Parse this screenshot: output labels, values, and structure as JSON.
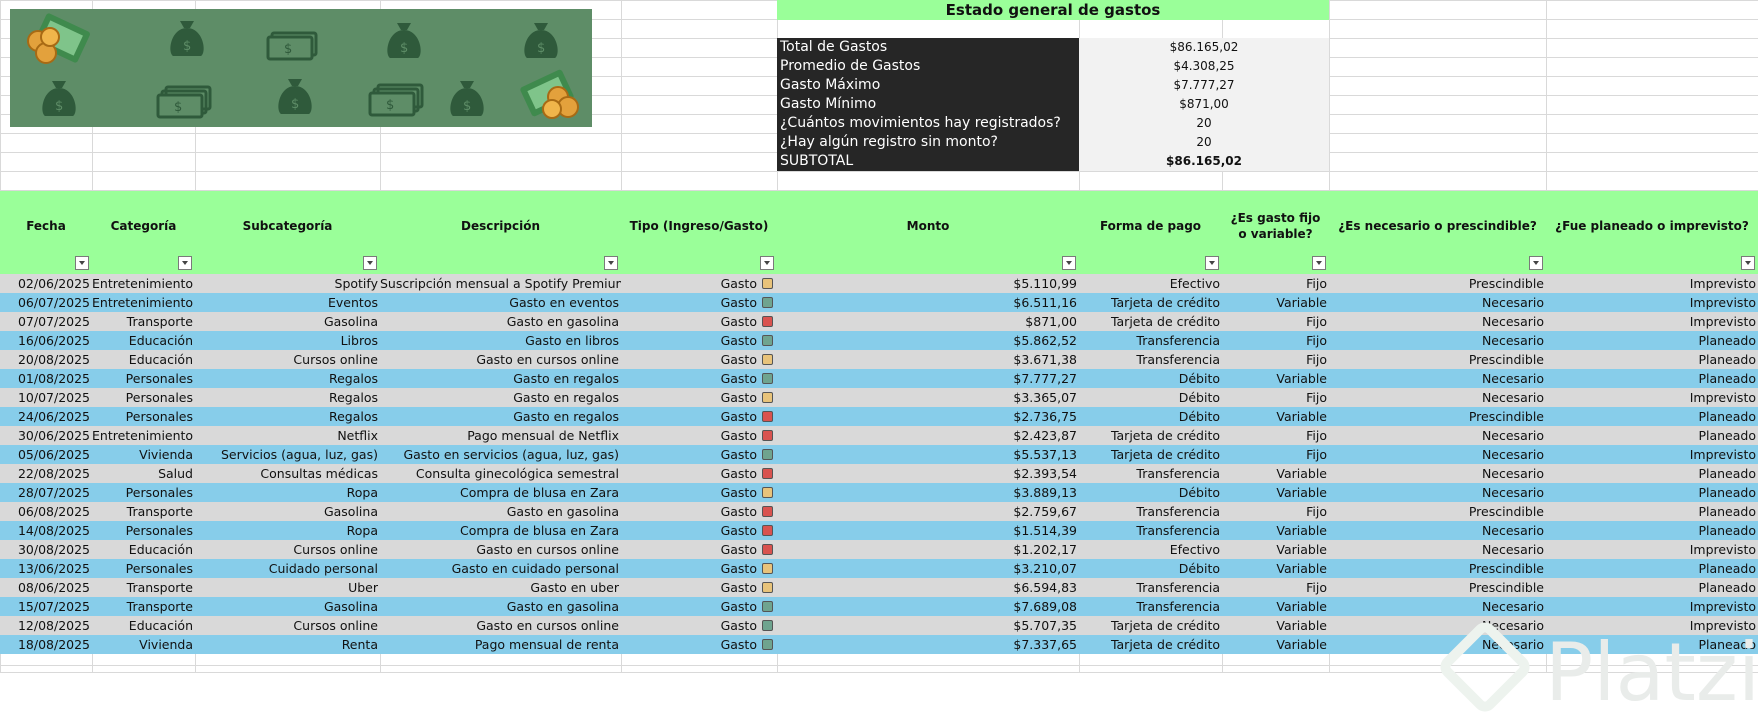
{
  "summary": {
    "title": "Estado general de gastos",
    "rows": [
      {
        "label": "Total de Gastos",
        "value": "$86.165,02"
      },
      {
        "label": "Promedio de Gastos",
        "value": "$4.308,25"
      },
      {
        "label": "Gasto Máximo",
        "value": "$7.777,27"
      },
      {
        "label": "Gasto Mínimo",
        "value": "$871,00"
      },
      {
        "label": "¿Cuántos movimientos hay registrados?",
        "value": "20"
      },
      {
        "label": "¿Hay algún registro sin monto?",
        "value": "20"
      },
      {
        "label": "SUBTOTAL",
        "value": "$86.165,02"
      }
    ]
  },
  "table": {
    "columns": [
      "Fecha",
      "Categoría",
      "Subcategoría",
      "Descripción",
      "Tipo (Ingreso/Gasto)",
      "Monto",
      "Forma de pago",
      "¿Es gasto fijo o variable?",
      "¿Es necesario o prescindible?",
      "¿Fue planeado o imprevisto?"
    ],
    "rows": [
      [
        "02/06/2025",
        "Entretenimiento",
        "Spotify",
        "Suscripción mensual a Spotify Premium",
        "Gasto",
        "$5.110,99",
        "Efectivo",
        "Fijo",
        "Prescindible",
        "Imprevisto"
      ],
      [
        "06/07/2025",
        "Entretenimiento",
        "Eventos",
        "Gasto en eventos",
        "Gasto",
        "$6.511,16",
        "Tarjeta de crédito",
        "Variable",
        "Necesario",
        "Imprevisto"
      ],
      [
        "07/07/2025",
        "Transporte",
        "Gasolina",
        "Gasto en gasolina",
        "Gasto",
        "$871,00",
        "Tarjeta de crédito",
        "Fijo",
        "Necesario",
        "Imprevisto"
      ],
      [
        "16/06/2025",
        "Educación",
        "Libros",
        "Gasto en libros",
        "Gasto",
        "$5.862,52",
        "Transferencia",
        "Fijo",
        "Necesario",
        "Planeado"
      ],
      [
        "20/08/2025",
        "Educación",
        "Cursos online",
        "Gasto en cursos online",
        "Gasto",
        "$3.671,38",
        "Transferencia",
        "Fijo",
        "Prescindible",
        "Planeado"
      ],
      [
        "01/08/2025",
        "Personales",
        "Regalos",
        "Gasto en regalos",
        "Gasto",
        "$7.777,27",
        "Débito",
        "Variable",
        "Necesario",
        "Planeado"
      ],
      [
        "10/07/2025",
        "Personales",
        "Regalos",
        "Gasto en regalos",
        "Gasto",
        "$3.365,07",
        "Débito",
        "Fijo",
        "Necesario",
        "Imprevisto"
      ],
      [
        "24/06/2025",
        "Personales",
        "Regalos",
        "Gasto en regalos",
        "Gasto",
        "$2.736,75",
        "Débito",
        "Variable",
        "Prescindible",
        "Planeado"
      ],
      [
        "30/06/2025",
        "Entretenimiento",
        "Netflix",
        "Pago mensual de Netflix",
        "Gasto",
        "$2.423,87",
        "Tarjeta de crédito",
        "Fijo",
        "Necesario",
        "Planeado"
      ],
      [
        "05/06/2025",
        "Vivienda",
        "Servicios (agua, luz, gas)",
        "Gasto en servicios (agua, luz, gas)",
        "Gasto",
        "$5.537,13",
        "Tarjeta de crédito",
        "Fijo",
        "Necesario",
        "Imprevisto"
      ],
      [
        "22/08/2025",
        "Salud",
        "Consultas médicas",
        "Consulta ginecológica semestral",
        "Gasto",
        "$2.393,54",
        "Transferencia",
        "Variable",
        "Necesario",
        "Planeado"
      ],
      [
        "28/07/2025",
        "Personales",
        "Ropa",
        "Compra de blusa en Zara",
        "Gasto",
        "$3.889,13",
        "Débito",
        "Variable",
        "Necesario",
        "Planeado"
      ],
      [
        "06/08/2025",
        "Transporte",
        "Gasolina",
        "Gasto en gasolina",
        "Gasto",
        "$2.759,67",
        "Transferencia",
        "Fijo",
        "Prescindible",
        "Planeado"
      ],
      [
        "14/08/2025",
        "Personales",
        "Ropa",
        "Compra de blusa en Zara",
        "Gasto",
        "$1.514,39",
        "Transferencia",
        "Variable",
        "Necesario",
        "Planeado"
      ],
      [
        "30/08/2025",
        "Educación",
        "Cursos online",
        "Gasto en cursos online",
        "Gasto",
        "$1.202,17",
        "Efectivo",
        "Variable",
        "Necesario",
        "Imprevisto"
      ],
      [
        "13/06/2025",
        "Personales",
        "Cuidado personal",
        "Gasto en cuidado personal",
        "Gasto",
        "$3.210,07",
        "Débito",
        "Variable",
        "Prescindible",
        "Planeado"
      ],
      [
        "08/06/2025",
        "Transporte",
        "Uber",
        "Gasto en uber",
        "Gasto",
        "$6.594,83",
        "Transferencia",
        "Fijo",
        "Prescindible",
        "Planeado"
      ],
      [
        "15/07/2025",
        "Transporte",
        "Gasolina",
        "Gasto en gasolina",
        "Gasto",
        "$7.689,08",
        "Transferencia",
        "Variable",
        "Necesario",
        "Imprevisto"
      ],
      [
        "12/08/2025",
        "Educación",
        "Cursos online",
        "Gasto en cursos online",
        "Gasto",
        "$5.707,35",
        "Tarjeta de crédito",
        "Variable",
        "Necesario",
        "Imprevisto"
      ],
      [
        "18/08/2025",
        "Vivienda",
        "Renta",
        "Pago mensual de renta",
        "Gasto",
        "$7.337,65",
        "Tarjeta de crédito",
        "Variable",
        "Necesario",
        "Planeado"
      ]
    ],
    "indicator_colors": [
      "#e8c37a",
      "#6fa48f",
      "#d9534f",
      "#6fa48f",
      "#e8c37a",
      "#6fa48f",
      "#e8c37a",
      "#d9534f",
      "#d9534f",
      "#6fa48f",
      "#d9534f",
      "#e8c37a",
      "#d9534f",
      "#d9534f",
      "#d9534f",
      "#e8c37a",
      "#e8c37a",
      "#6fa48f",
      "#6fa48f",
      "#6fa48f"
    ]
  },
  "banner": {
    "icons": [
      "coins-cash-icon",
      "money-bag-icon",
      "banknote-icon",
      "money-bag-icon",
      "money-bag-icon",
      "money-bag-icon",
      "banknote-stack-icon",
      "money-bag-icon",
      "banknote-stack-icon",
      "money-bag-icon",
      "cash-coins-icon"
    ]
  },
  "watermark": "Platzi",
  "colors": {
    "header_green": "#9aff99",
    "row_gray": "#d9d9d9",
    "row_blue": "#87cdea",
    "summary_dark": "#262626",
    "banner_green": "#5e8d67"
  }
}
